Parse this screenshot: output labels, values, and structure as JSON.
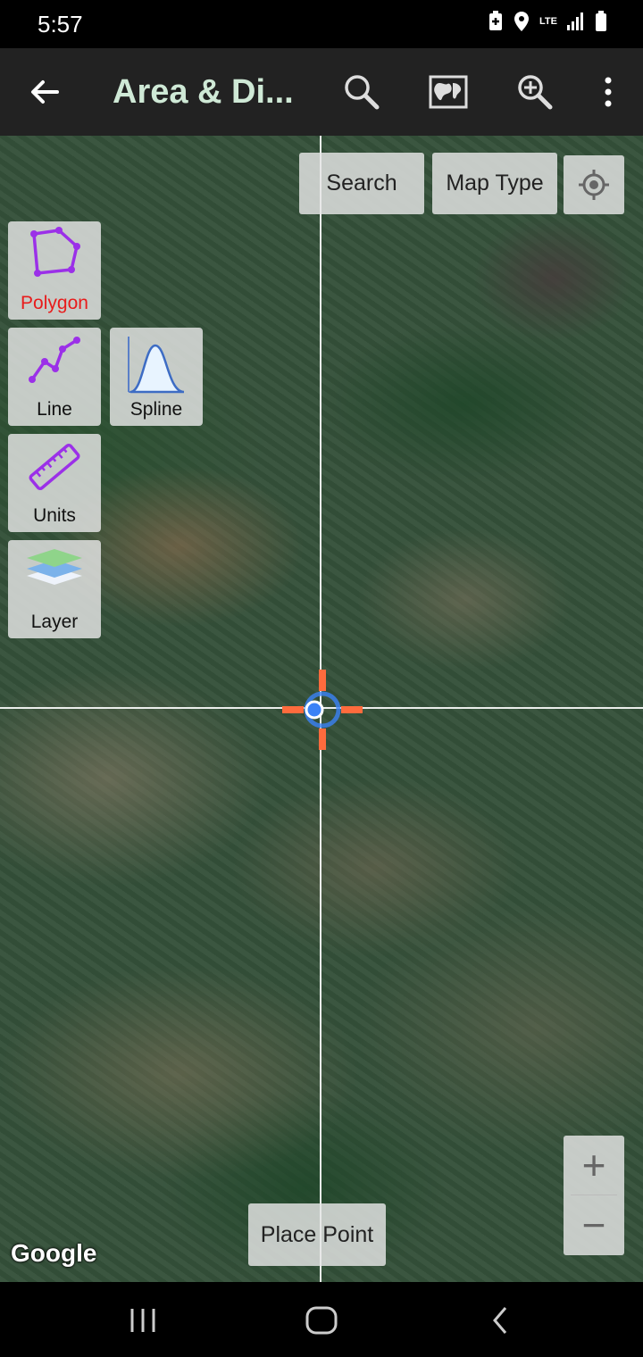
{
  "status_bar": {
    "time": "5:57",
    "network": "LTE"
  },
  "app_bar": {
    "title": "Area & Di...",
    "icons": [
      "back-arrow-icon",
      "search-icon",
      "map-view-icon",
      "zoom-in-icon",
      "more-vertical-icon"
    ]
  },
  "map": {
    "search_button": "Search",
    "map_type_button": "Map Type",
    "tools": {
      "polygon": "Polygon",
      "line": "Line",
      "spline": "Spline",
      "units": "Units",
      "layer": "Layer"
    },
    "place_point_button": "Place Point",
    "zoom_in": "+",
    "zoom_out": "−",
    "attribution": "Google"
  },
  "colors": {
    "title_text": "#cfe9d6",
    "polygon_label": "#e81b1b",
    "crosshair_marker": "#ff6b3d",
    "location_dot": "#3b82f6",
    "tool_icon": "#9b30e8"
  }
}
